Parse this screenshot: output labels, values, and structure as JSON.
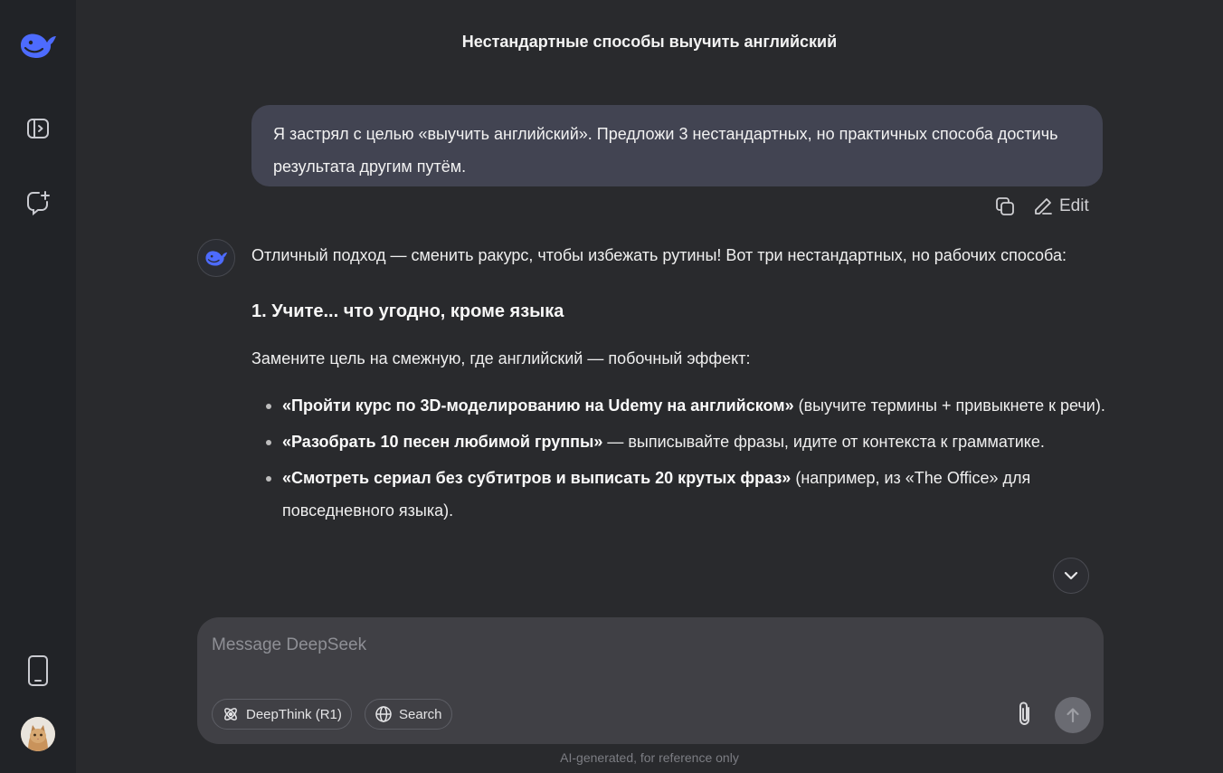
{
  "sidebar": {
    "logo_icon": "deepseek-whale-logo",
    "toggle_icon": "sidebar-toggle-icon",
    "new_chat_icon": "new-chat-icon",
    "app_icon": "mobile-phone-icon",
    "avatar_icon": "user-avatar-cat"
  },
  "header": {
    "title": "Нестандартные способы выучить английский"
  },
  "conversation": {
    "user_message": "Я застрял с целью «выучить английский». Предложи 3 нестандартных, но практичных способа достичь результата другим путём.",
    "actions": {
      "edit_label": "Edit"
    },
    "answer": {
      "intro": "Отличный подход — сменить ракурс, чтобы избежать рутины! Вот три нестандартных, но рабочих способа:",
      "heading1": "1. Учите... что угодно, кроме языка",
      "para": "Замените цель на смежную, где английский — побочный эффект:",
      "bullets": [
        {
          "bold": "«Пройти курс по 3D-моделированию на Udemy на английском»",
          "rest": " (выучите термины + привыкнете к речи)."
        },
        {
          "bold": "«Разобрать 10 песен любимой группы»",
          "rest": " — выписывайте фразы, идите от контекста к грамматике."
        },
        {
          "bold": "«Смотреть сериал без субтитров и выписать 20 крутых фраз»",
          "rest": " (например, из «The Office» для повседневного языка)."
        }
      ]
    }
  },
  "composer": {
    "placeholder": "Message DeepSeek",
    "deepthink_label": "DeepThink (R1)",
    "search_label": "Search"
  },
  "footer": {
    "note": "AI-generated, for reference only"
  },
  "colors": {
    "accent": "#4d6bfe",
    "background": "#292a2d",
    "sidebar": "#212327",
    "user_bubble": "#424452"
  }
}
